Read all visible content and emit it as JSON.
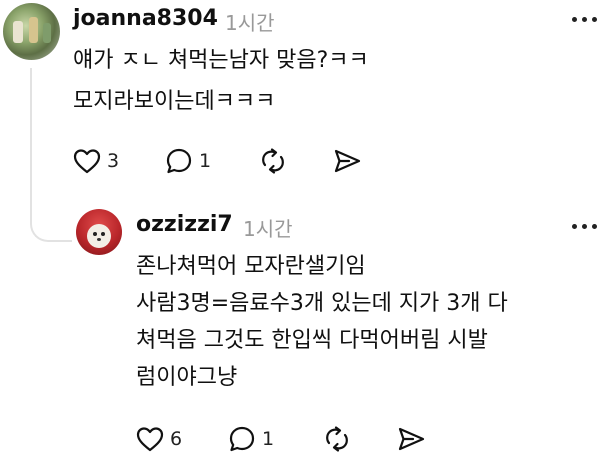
{
  "comment1": {
    "username": "joanna8304",
    "time": "1시간",
    "lines": [
      "얘가 ㅈㄴ 쳐먹는남자 맞음?ㅋㅋ",
      "모지라보이는데ㅋㅋㅋ"
    ],
    "likes": "3",
    "replies": "1"
  },
  "comment2": {
    "username": "ozzizzi7",
    "time": "1시간",
    "lines": [
      "존나쳐먹어 모자란샐기임",
      "사람3명=음료수3개 있는데 지가 3개 다",
      "쳐먹음 그것도 한입씩 다먹어버림 시발",
      "럼이야그냥"
    ],
    "likes": "6",
    "replies": "1"
  },
  "icons": [
    "heart-icon",
    "comment-icon",
    "repost-icon",
    "share-icon",
    "more-icon"
  ]
}
